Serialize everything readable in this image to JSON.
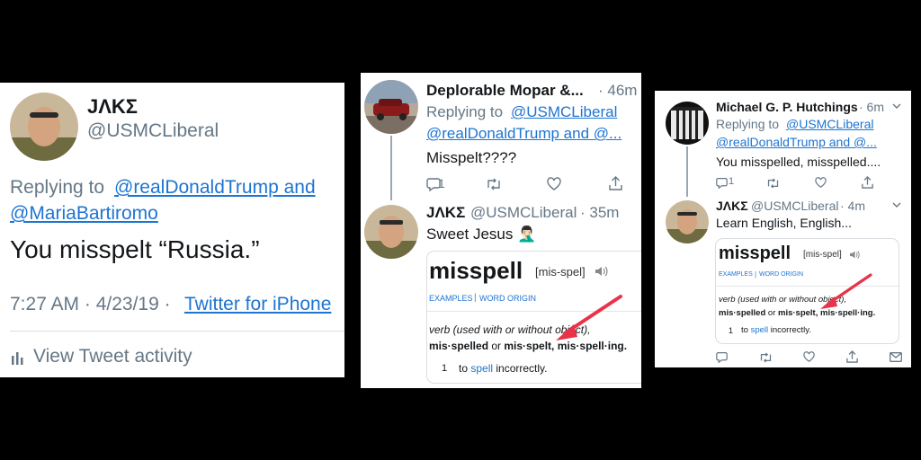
{
  "panel1": {
    "display_name": "JΛKΣ",
    "handle": "@USMCLiberal",
    "replying_to": "Replying to",
    "reply_user1": "@realDonaldTrump and",
    "reply_user2": "@MariaBartiromo",
    "tweet_text": "You misspelt “Russia.”",
    "timestamp": "7:27 AM · 4/23/19 ·",
    "source": "Twitter for iPhone",
    "activity": "View Tweet activity"
  },
  "panel2": {
    "tweet1": {
      "display_name": "Deplorable Mopar &...",
      "time": "· 46m",
      "replying_to": "Replying to",
      "reply_user1": "@USMCLiberal",
      "reply_user2": "@realDonaldTrump and @...",
      "text": "Misspelt????",
      "reply_count": "1"
    },
    "tweet2": {
      "display_name": "JΛKΣ",
      "handle": "@USMCLiberal",
      "time": "· 35m",
      "text": "Sweet Jesus 🤦🏻‍♂️"
    },
    "dict": {
      "word": "misspell",
      "pron": "[mis-spel]",
      "examples": "EXAMPLES",
      "sep": "|",
      "origin": "WORD ORIGIN",
      "pos": "verb (used with or without object),",
      "forms_a": "mis·spelled",
      "forms_or": " or ",
      "forms_b": "mis·spelt, mis·spell·ing.",
      "def_num": "1",
      "def_to": "to ",
      "def_link": "spell",
      "def_rest": " incorrectly."
    }
  },
  "panel3": {
    "tweet1": {
      "display_name": "Michael G. P. Hutchings",
      "time": "· 6m",
      "replying_to": "Replying to",
      "reply_user1": "@USMCLiberal",
      "reply_user2": "@realDonaldTrump and @...",
      "text": "You misspelled, misspelled....",
      "reply_count": "1"
    },
    "tweet2": {
      "display_name": "JΛKΣ",
      "handle": "@USMCLiberal",
      "time": "· 4m",
      "text": "Learn English, English..."
    },
    "dict": {
      "word": "misspell",
      "pron": "[mis-spel]",
      "examples": "EXAMPLES",
      "sep": "|",
      "origin": "WORD ORIGIN",
      "pos": "verb (used with or without object),",
      "forms_a": "mis·spelled",
      "forms_or": " or ",
      "forms_b": "mis·spelt, mis·spell·ing.",
      "def_num": "1",
      "def_to": "to ",
      "def_link": "spell",
      "def_rest": " incorrectly."
    }
  },
  "colors": {
    "link": "#1d74d2",
    "arrow": "#e8334a",
    "background": "#000000"
  }
}
